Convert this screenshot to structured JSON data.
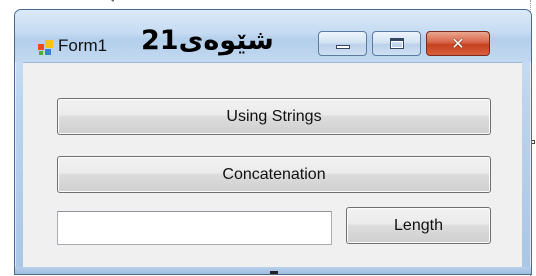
{
  "window": {
    "title": "Form1",
    "overlay_text": "شێوەی21",
    "icon": "windows-form-icon",
    "caption_buttons": {
      "minimize_icon": "minimize-icon",
      "maximize_icon": "maximize-icon",
      "close_icon": "close-icon",
      "close_glyph": "✕"
    }
  },
  "form": {
    "buttons": {
      "using_strings": "Using Strings",
      "concatenation": "Concatenation",
      "length": "Length"
    },
    "textbox": {
      "value": "",
      "placeholder": ""
    }
  },
  "colors": {
    "close_button": "#c6411e",
    "client_background": "#f0f0f0",
    "frame": "#b9d3ee"
  }
}
